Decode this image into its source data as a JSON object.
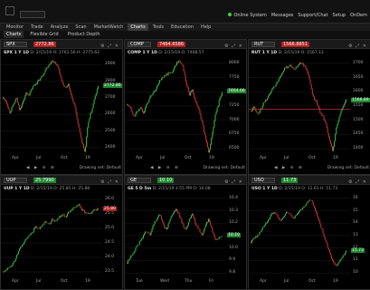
{
  "topbar": {
    "status": "Online System",
    "messages": "Messages",
    "support": "Support/Chat",
    "setup": "Setup",
    "on_demand": "OnDem"
  },
  "menu": [
    "Monitor",
    "Trade",
    "Analyze",
    "Scan",
    "MarketWatch",
    "Charts",
    "Tools",
    "Education",
    "Help"
  ],
  "menu_active": "Charts",
  "submenu": [
    "Charts",
    "Flexible Grid",
    "Product Depth"
  ],
  "submenu_active": "Charts",
  "colors": {
    "up": "#3fd04f",
    "down": "#e03a3a",
    "axis": "#a5a5a5"
  },
  "panels": [
    {
      "symbol": "SPX",
      "price": "2772.86",
      "price_dir": "neg",
      "title": "SPX 1 Y 1D",
      "info": "D: 2/15/19  O: 2761.56  H: 2775.62",
      "y_labels": [
        "2900",
        "2800",
        "2700",
        "2600",
        "2500",
        "2400"
      ],
      "last_tag": "2772.86",
      "x_labels": [
        "Apr",
        "Jul",
        "Oct",
        "19"
      ],
      "draw_label": "Drawing set: Default",
      "chart_data": {
        "type": "candlestick",
        "x_range": [
          "2018-02",
          "2019-02"
        ],
        "ylim": [
          2340,
          2960
        ],
        "closes": [
          2700,
          2680,
          2610,
          2650,
          2700,
          2630,
          2670,
          2730,
          2720,
          2770,
          2790,
          2810,
          2840,
          2880,
          2910,
          2930,
          2920,
          2880,
          2790,
          2760,
          2780,
          2700,
          2640,
          2520,
          2430,
          2360,
          2550,
          2620,
          2700,
          2772
        ]
      }
    },
    {
      "symbol": "COMP",
      "price": "7464.6586",
      "price_dir": "neg",
      "title": "COMP 1 Y 1D",
      "info": "D: 2/15/19  O: 7468.57",
      "y_labels": [
        "8000",
        "7750",
        "7500",
        "7250",
        "7000",
        "6750",
        "6500"
      ],
      "last_tag": "7464.66",
      "x_labels": [
        "Apr",
        "Jul",
        "Oct",
        "19"
      ],
      "draw_label": "Drawing set: Default",
      "chart_data": {
        "type": "candlestick",
        "x_range": [
          "2018-02",
          "2019-02"
        ],
        "ylim": [
          6150,
          8200
        ],
        "closes": [
          7200,
          7150,
          6950,
          7050,
          7150,
          7050,
          7200,
          7350,
          7450,
          7550,
          7700,
          7750,
          7820,
          7850,
          7900,
          8050,
          8100,
          8000,
          7650,
          7400,
          7500,
          7250,
          7100,
          6800,
          6500,
          6200,
          6600,
          7000,
          7250,
          7464
        ]
      }
    },
    {
      "symbol": "RUT",
      "price": "1566.8851",
      "price_dir": "neg",
      "title": "RUT 1 Y 1D",
      "info": "D: 2/15/19  O: 1567.13",
      "y_labels": [
        "1700",
        "1650",
        "1600",
        "1550",
        "1500",
        "1450",
        "1400"
      ],
      "last_tag": "1566.89",
      "x_labels": [
        "Apr",
        "Jul",
        "Oct",
        "19"
      ],
      "draw_label": "Drawing set: Default",
      "chart_data": {
        "type": "candlestick",
        "x_range": [
          "2018-02",
          "2019-02"
        ],
        "ylim": [
          1340,
          1745
        ],
        "hline": 1530,
        "closes": [
          1520,
          1540,
          1510,
          1530,
          1560,
          1570,
          1600,
          1620,
          1640,
          1670,
          1690,
          1700,
          1710,
          1690,
          1700,
          1720,
          1710,
          1690,
          1640,
          1580,
          1560,
          1520,
          1500,
          1460,
          1400,
          1360,
          1450,
          1500,
          1540,
          1566
        ]
      }
    },
    {
      "symbol": "UUP",
      "price": "25.7990",
      "price_dir": "pos",
      "title": "UUP 1 Y 1D",
      "info": "D: 2/15/19  O: 25.85  H: 25.88",
      "y_labels": [
        "26.0",
        "25.5",
        "25.0",
        "24.5",
        "24.0",
        "23.5"
      ],
      "last_tag": "25.80",
      "x_labels": [
        "Apr",
        "Jul",
        "Oct",
        "19"
      ],
      "draw_label": "",
      "chart_data": {
        "type": "candlestick",
        "x_range": [
          "2018-02",
          "2019-02"
        ],
        "ylim": [
          23.0,
          26.5
        ],
        "closes": [
          23.3,
          23.4,
          23.5,
          23.6,
          23.9,
          24.2,
          24.4,
          24.6,
          24.8,
          24.9,
          25.1,
          25.0,
          25.2,
          25.3,
          25.2,
          25.4,
          25.3,
          25.5,
          25.6,
          25.5,
          25.7,
          25.8,
          25.9,
          26.0,
          25.8,
          25.7,
          25.6,
          25.7,
          25.8,
          25.8
        ]
      }
    },
    {
      "symbol": "GE",
      "price": "10.10",
      "price_dir": "pos",
      "title": "GE 5 D 5m",
      "info": "D: 2/15/19 3:55 PM  O: 10.08",
      "y_labels": [
        "10.4",
        "10.3",
        "10.2",
        "10.1",
        "10.0",
        "9.9",
        "9.8"
      ],
      "last_tag": "10.10",
      "x_labels": [
        "Tue",
        "Wed",
        "Thu",
        "Fri"
      ],
      "draw_label": "",
      "chart_data": {
        "type": "candlestick",
        "x_range": [
          "Mon",
          "Fri"
        ],
        "ylim": [
          9.7,
          10.5
        ],
        "closes": [
          9.85,
          9.9,
          9.95,
          10.0,
          10.05,
          10.1,
          10.15,
          10.1,
          10.2,
          10.25,
          10.3,
          10.2,
          10.15,
          10.25,
          10.3,
          10.35,
          10.28,
          10.2,
          10.15,
          10.25,
          10.3,
          10.2,
          10.15,
          10.1,
          10.2,
          10.25,
          10.15,
          10.05,
          10.08,
          10.1
        ]
      }
    },
    {
      "symbol": "USO",
      "price": "11.73",
      "price_dir": "pos",
      "title": "USO 1 Y 1D",
      "info": "D: 2/15/19  O: 11.61  H: 11.73",
      "y_labels": [
        "16",
        "15",
        "14",
        "13",
        "12",
        "11",
        "10"
      ],
      "last_tag": "11.73",
      "x_labels": [
        "Apr",
        "Jul",
        "Oct",
        "19"
      ],
      "draw_label": "",
      "chart_data": {
        "type": "candlestick",
        "x_range": [
          "2018-02",
          "2019-02"
        ],
        "ylim": [
          9.5,
          16.5
        ],
        "closes": [
          12.5,
          12.8,
          13.0,
          13.4,
          13.8,
          14.1,
          14.6,
          14.9,
          14.6,
          14.2,
          14.5,
          14.9,
          14.7,
          14.4,
          14.7,
          15.0,
          15.2,
          15.6,
          16.0,
          15.5,
          14.8,
          14.0,
          13.2,
          12.4,
          11.6,
          10.9,
          10.6,
          10.9,
          11.3,
          11.73
        ]
      }
    }
  ]
}
